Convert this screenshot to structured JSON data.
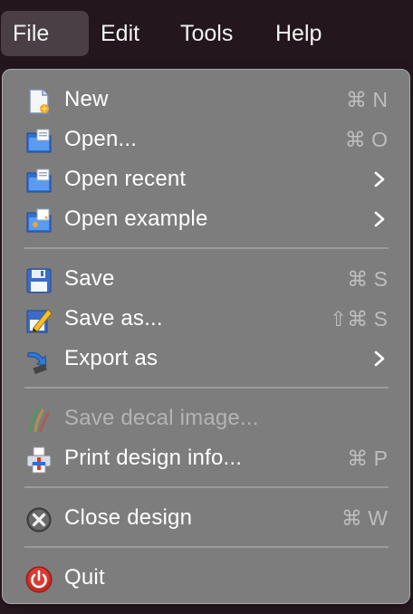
{
  "menubar": {
    "items": [
      {
        "label": "File",
        "active": true
      },
      {
        "label": "Edit"
      },
      {
        "label": "Tools"
      },
      {
        "label": "Help"
      }
    ]
  },
  "menu": {
    "items": [
      {
        "label": "New",
        "shortcut": "⌘ N",
        "icon": "new-document-icon"
      },
      {
        "label": "Open...",
        "shortcut": "⌘ O",
        "icon": "open-folder-icon"
      },
      {
        "label": "Open recent",
        "submenu": true,
        "icon": "open-recent-folder-icon"
      },
      {
        "label": "Open example",
        "submenu": true,
        "icon": "open-example-folder-icon"
      },
      {
        "label": "Save",
        "shortcut": "⌘ S",
        "icon": "floppy-disk-icon"
      },
      {
        "label": "Save as...",
        "shortcut": "⇧⌘ S",
        "icon": "save-as-pencil-icon"
      },
      {
        "label": "Export as",
        "submenu": true,
        "icon": "export-arrow-icon"
      },
      {
        "label": "Save decal image...",
        "disabled": true,
        "icon": "decal-brush-icon"
      },
      {
        "label": "Print design info...",
        "shortcut": "⌘ P",
        "icon": "printer-icon"
      },
      {
        "label": "Close design",
        "shortcut": "⌘ W",
        "icon": "close-circle-icon"
      },
      {
        "label": "Quit",
        "icon": "power-icon"
      }
    ]
  }
}
